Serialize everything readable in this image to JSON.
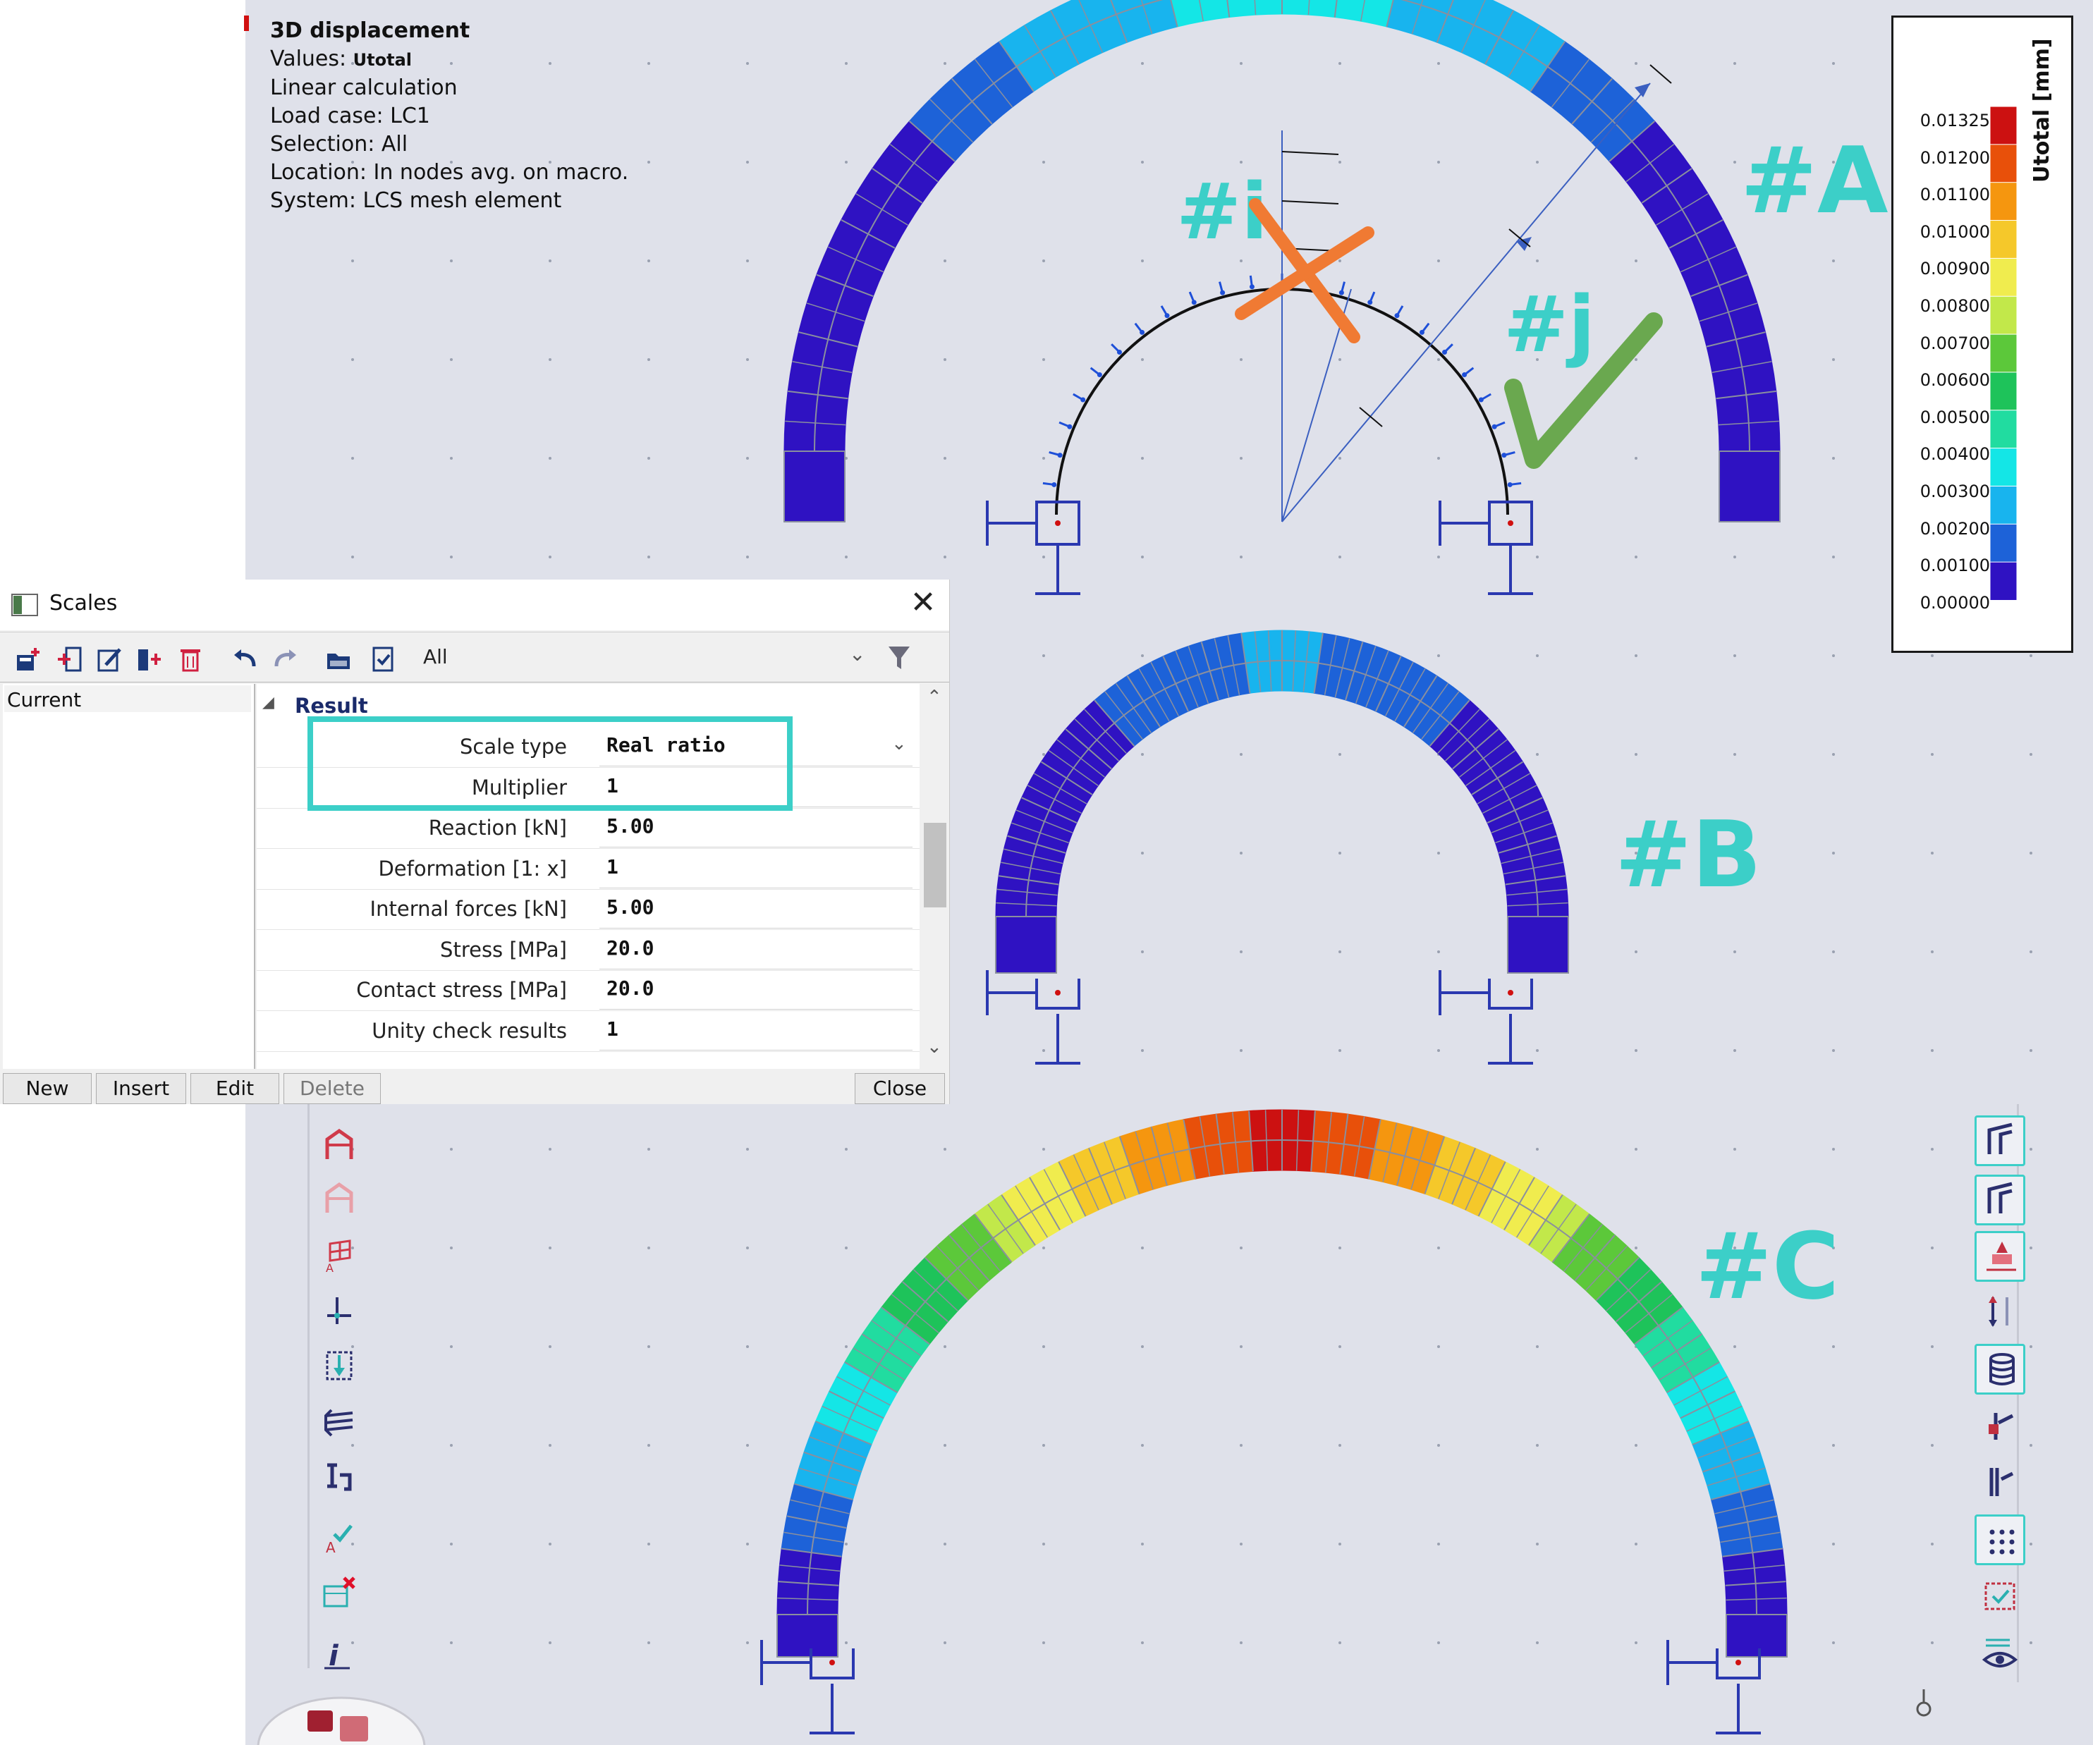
{
  "info": {
    "title": "3D displacement",
    "values_prefix": "Values: ",
    "values_name": "Utotal",
    "calc": "Linear calculation",
    "load_case": "Load case: LC1",
    "selection": "Selection: All",
    "location": "Location: In nodes avg. on macro.",
    "system": "System: LCS mesh element"
  },
  "legend": {
    "title": "Utotal [mm]",
    "values": [
      "0.01325",
      "0.01200",
      "0.01100",
      "0.01000",
      "0.00900",
      "0.00800",
      "0.00700",
      "0.00600",
      "0.00500",
      "0.00400",
      "0.00300",
      "0.00200",
      "0.00100",
      "0.00000"
    ],
    "colors": [
      "#cc1111",
      "#e8500a",
      "#f5960f",
      "#f5c82a",
      "#f0ec4e",
      "#c2e84a",
      "#5cc83a",
      "#1ec35a",
      "#21dca0",
      "#14e6e6",
      "#18b4ee",
      "#1d62d8",
      "#2f12c2"
    ]
  },
  "labels": {
    "a": "#A",
    "b": "#B",
    "c": "#C",
    "i": "#i",
    "j": "#j"
  },
  "dialog": {
    "title": "Scales",
    "close_glyph": "✕",
    "filter_value": "All",
    "current_label": "Current",
    "group_header": "Result",
    "rows": [
      {
        "name": "Scale type",
        "value": "Real ratio"
      },
      {
        "name": "Multiplier",
        "value": "1"
      },
      {
        "name": "Reaction [kN]",
        "value": "5.00"
      },
      {
        "name": "Deformation [1: x]",
        "value": "1"
      },
      {
        "name": "Internal forces [kN]",
        "value": "5.00"
      },
      {
        "name": "Stress [MPa]",
        "value": "20.0"
      },
      {
        "name": "Contact stress [MPa]",
        "value": "20.0"
      },
      {
        "name": "Unity check results",
        "value": "1"
      }
    ],
    "buttons": {
      "new": "New",
      "insert": "Insert",
      "edit": "Edit",
      "delete": "Delete",
      "close": "Close"
    }
  },
  "icons": {
    "left_toolbar": [
      "portal-frame-icon",
      "portal-frame-dim-icon",
      "slab-grid-icon",
      "axis-member-icon",
      "load-panel-icon",
      "layers-icon",
      "cross-section-icon",
      "check-member-icon",
      "table-delete-icon",
      "info-axis-icon"
    ],
    "right_toolbar": [
      "frame-icon",
      "frame-highlight-icon",
      "user-node-icon",
      "supports-icon",
      "database-icon",
      "connection-icon",
      "member-end-icon",
      "grid-points-icon",
      "select-region-icon",
      "view-eye-icon"
    ]
  }
}
